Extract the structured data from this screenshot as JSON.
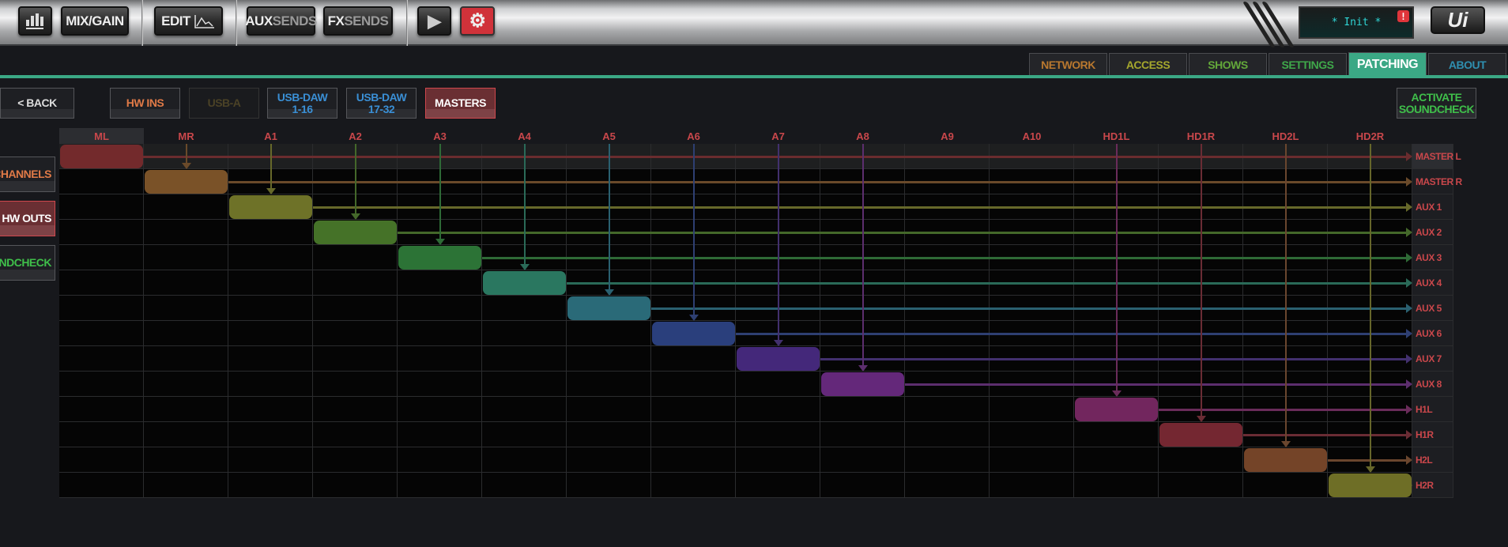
{
  "toolbar": {
    "meters_icon": "meters-icon",
    "mix_gain": "MIX/GAIN",
    "edit": "EDIT",
    "aux_a": "AUX",
    "aux_b": "SENDS",
    "fx_a": "FX",
    "fx_b": "SENDS",
    "play_icon": "▶",
    "settings_icon": "⚙",
    "display_text": "* Init *",
    "alert": "!",
    "logo": "Ui"
  },
  "tabs": [
    {
      "label": "NETWORK",
      "color": "#b9782f"
    },
    {
      "label": "ACCESS",
      "color": "#a5a72d"
    },
    {
      "label": "SHOWS",
      "color": "#63a83a"
    },
    {
      "label": "SETTINGS",
      "color": "#3fa84a"
    },
    {
      "label": "PATCHING",
      "color": "#ffffff",
      "active": true
    },
    {
      "label": "ABOUT",
      "color": "#2f8fb0"
    }
  ],
  "nav": {
    "back": "< BACK",
    "activate_1": "ACTIVATE",
    "activate_2": "SOUNDCHECK"
  },
  "sources": [
    {
      "label": "HW INS",
      "color": "#e07a47"
    },
    {
      "label": "USB-A",
      "color": "#4b4226"
    },
    {
      "label": "USB-DAW",
      "sub": "1-16",
      "color": "#3a8fd5"
    },
    {
      "label": "USB-DAW",
      "sub": "17-32",
      "color": "#3a8fd5"
    },
    {
      "label": "MASTERS",
      "color": "#ffffff",
      "selected": true
    }
  ],
  "side": [
    {
      "label": "CHANNELS",
      "color": "#e07a47"
    },
    {
      "label": "HW OUTS",
      "color": "#ffffff",
      "selected": true
    },
    {
      "label": "SOUNDCHECK",
      "color": "#3fbf4a"
    }
  ],
  "columns": [
    "ML",
    "MR",
    "A1",
    "A2",
    "A3",
    "A4",
    "A5",
    "A6",
    "A7",
    "A8",
    "A9",
    "A10",
    "HD1L",
    "HD1R",
    "HD2L",
    "HD2R"
  ],
  "rows": [
    {
      "label": "MASTER L",
      "patch": 0,
      "color": "#732a2c",
      "line": "#6a2c2e"
    },
    {
      "label": "MASTER R",
      "patch": 1,
      "color": "#7a5228",
      "line": "#6a4a2a"
    },
    {
      "label": "AUX 1",
      "patch": 2,
      "color": "#6e7228",
      "line": "#66682a"
    },
    {
      "label": "AUX 2",
      "patch": 3,
      "color": "#457228",
      "line": "#44682a"
    },
    {
      "label": "AUX 3",
      "patch": 4,
      "color": "#2c7336",
      "line": "#2e6a36"
    },
    {
      "label": "AUX 4",
      "patch": 5,
      "color": "#2a7760",
      "line": "#2a6a58"
    },
    {
      "label": "AUX 5",
      "patch": 6,
      "color": "#2a6a78",
      "line": "#2a6070"
    },
    {
      "label": "AUX 6",
      "patch": 7,
      "color": "#2a3f7c",
      "line": "#2e3f72"
    },
    {
      "label": "AUX 7",
      "patch": 8,
      "color": "#44287a",
      "line": "#42306e"
    },
    {
      "label": "AUX 8",
      "patch": 9,
      "color": "#64287a",
      "line": "#5c2e6e"
    },
    {
      "label": "H1L",
      "patch": 12,
      "color": "#72265e",
      "line": "#6a2c5a"
    },
    {
      "label": "H1R",
      "patch": 13,
      "color": "#742731",
      "line": "#6a2c34"
    },
    {
      "label": "H2L",
      "patch": 14,
      "color": "#744428",
      "line": "#6a462e"
    },
    {
      "label": "H2R",
      "patch": 15,
      "color": "#6e6e26",
      "line": "#66662a"
    }
  ]
}
